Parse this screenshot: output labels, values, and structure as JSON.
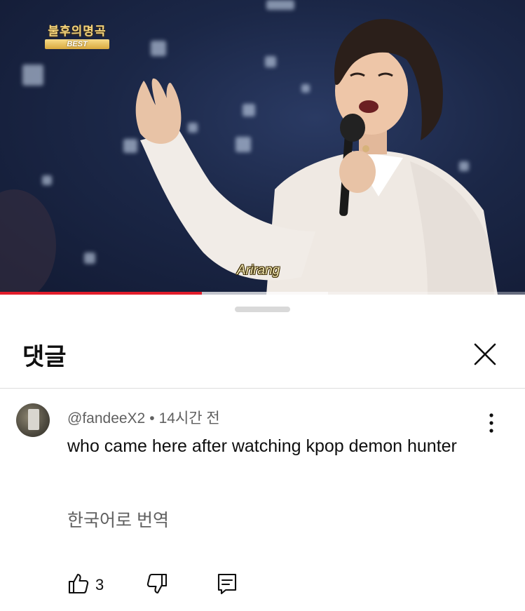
{
  "video": {
    "logo_title": "불후의명곡",
    "logo_badge": "BEST",
    "subtitle": "Arirang",
    "progress_played": 0.385,
    "progress_buffered": 0.625
  },
  "comments_panel": {
    "title": "댓글",
    "close_icon": "close-icon"
  },
  "comment": {
    "author": "@fandeeX2",
    "separator": "•",
    "time": "14시간 전",
    "text": "who came here after watching kpop demon hunter",
    "translate_label": "한국어로 번역",
    "like_count": "3"
  },
  "icons": {
    "like": "thumbs-up-icon",
    "dislike": "thumbs-down-icon",
    "reply": "reply-icon",
    "more": "more-vertical-icon"
  },
  "colors": {
    "progress_red": "#e21d2b",
    "text_primary": "#0f0f0f",
    "text_secondary": "#606060"
  }
}
